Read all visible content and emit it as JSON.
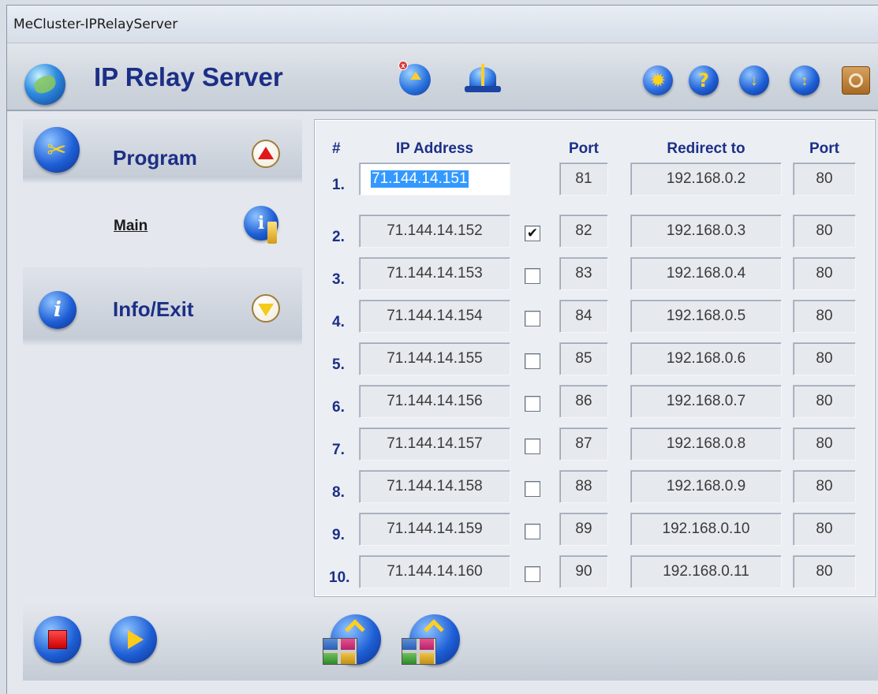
{
  "window": {
    "title": "MeCluster-IPRelayServer"
  },
  "header": {
    "app_title": "IP Relay Server",
    "toolbar_icons": [
      "relay-disconnect-icon",
      "beacon-icon",
      "gear-icon",
      "help-icon",
      "download-icon",
      "updown-icon",
      "power-icon"
    ],
    "help_glyph": "?"
  },
  "sidebar": {
    "program": {
      "label": "Program"
    },
    "main_link": "Main",
    "info_exit": {
      "label": "Info/Exit",
      "icon_glyph": "i"
    }
  },
  "table": {
    "headers": {
      "num": "#",
      "ip": "IP Address",
      "port": "Port",
      "redirect": "Redirect to",
      "port2": "Port"
    },
    "rows": [
      {
        "num": "1.",
        "ip": "71.144.14.151",
        "checkbox": null,
        "port": "81",
        "redirect": "192.168.0.2",
        "port2": "80"
      },
      {
        "num": "2.",
        "ip": "71.144.14.152",
        "checkbox": true,
        "port": "82",
        "redirect": "192.168.0.3",
        "port2": "80"
      },
      {
        "num": "3.",
        "ip": "71.144.14.153",
        "checkbox": false,
        "port": "83",
        "redirect": "192.168.0.4",
        "port2": "80"
      },
      {
        "num": "4.",
        "ip": "71.144.14.154",
        "checkbox": false,
        "port": "84",
        "redirect": "192.168.0.5",
        "port2": "80"
      },
      {
        "num": "5.",
        "ip": "71.144.14.155",
        "checkbox": false,
        "port": "85",
        "redirect": "192.168.0.6",
        "port2": "80"
      },
      {
        "num": "6.",
        "ip": "71.144.14.156",
        "checkbox": false,
        "port": "86",
        "redirect": "192.168.0.7",
        "port2": "80"
      },
      {
        "num": "7.",
        "ip": "71.144.14.157",
        "checkbox": false,
        "port": "87",
        "redirect": "192.168.0.8",
        "port2": "80"
      },
      {
        "num": "8.",
        "ip": "71.144.14.158",
        "checkbox": false,
        "port": "88",
        "redirect": "192.168.0.9",
        "port2": "80"
      },
      {
        "num": "9.",
        "ip": "71.144.14.159",
        "checkbox": false,
        "port": "89",
        "redirect": "192.168.0.10",
        "port2": "80"
      },
      {
        "num": "10.",
        "ip": "71.144.14.160",
        "checkbox": false,
        "port": "90",
        "redirect": "192.168.0.11",
        "port2": "80"
      }
    ]
  },
  "bottom": {
    "buttons": [
      "stop-icon",
      "play-icon",
      "network-up-icon",
      "network-up-icon"
    ]
  },
  "colors": {
    "accent": "#1c2f86",
    "selection": "#3399ff",
    "stop": "#e0171b",
    "play": "#ffcb1c"
  }
}
